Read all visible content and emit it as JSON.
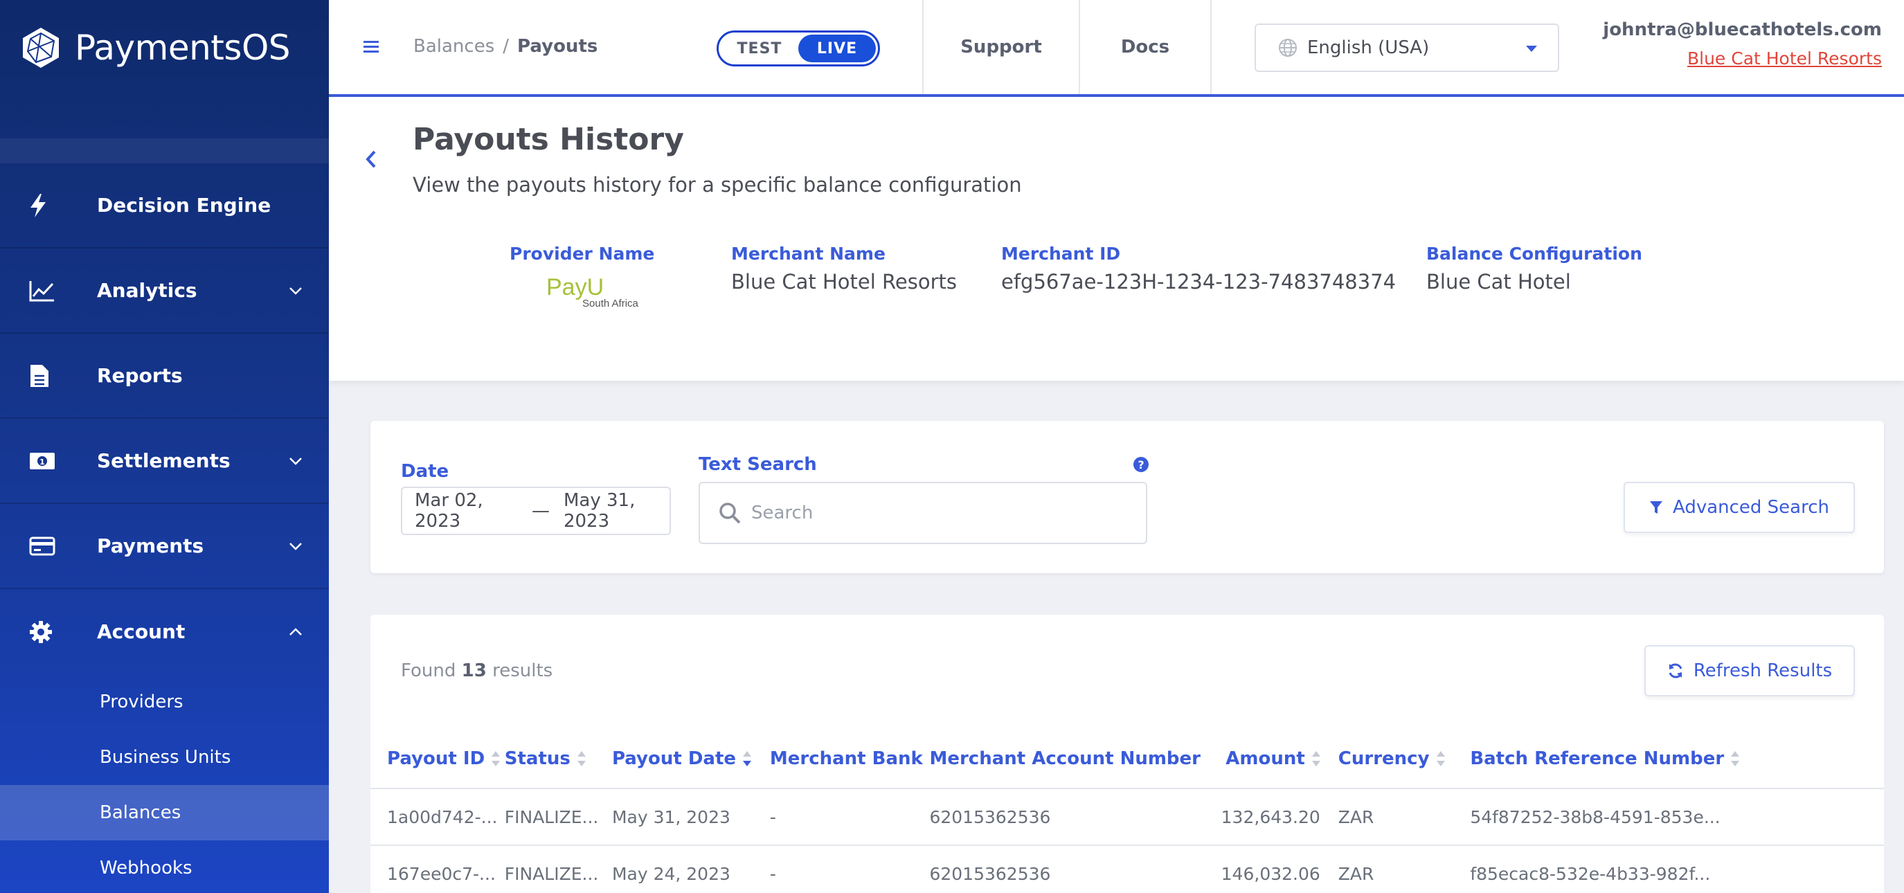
{
  "app": {
    "name": "PaymentsOS"
  },
  "sidebar": {
    "items": [
      {
        "label": "Decision Engine",
        "icon": "bolt-icon"
      },
      {
        "label": "Analytics",
        "icon": "line-chart-icon"
      },
      {
        "label": "Reports",
        "icon": "document-icon"
      },
      {
        "label": "Settlements",
        "icon": "money-icon"
      },
      {
        "label": "Payments",
        "icon": "credit-card-icon"
      },
      {
        "label": "Account",
        "icon": "gear-icon"
      }
    ],
    "account_sub": [
      "Providers",
      "Business Units",
      "Balances",
      "Webhooks"
    ],
    "active_sub": "Balances"
  },
  "topbar": {
    "breadcrumb_parent": "Balances",
    "breadcrumb_sep": "/",
    "breadcrumb_current": "Payouts",
    "env_test": "TEST",
    "env_live": "LIVE",
    "support": "Support",
    "docs": "Docs",
    "language": "English (USA)",
    "user_email": "johntra@bluecathotels.com",
    "user_company": "Blue Cat Hotel Resorts"
  },
  "header": {
    "title": "Payouts History",
    "subtitle": "View the payouts history for a specific balance configuration",
    "provider_label": "Provider Name",
    "provider_logo_text": "PayU",
    "provider_logo_sub": "South Africa",
    "merchant_name_label": "Merchant Name",
    "merchant_name": "Blue Cat Hotel Resorts",
    "merchant_id_label": "Merchant ID",
    "merchant_id": "efg567ae-123H-1234-123-7483748374",
    "balance_config_label": "Balance Configuration",
    "balance_config": "Blue Cat Hotel"
  },
  "search": {
    "date_label": "Date",
    "date_from": "Mar 02, 2023",
    "date_sep": "—",
    "date_to": "May 31, 2023",
    "text_label": "Text Search",
    "placeholder": "Search",
    "advanced_button": "Advanced Search"
  },
  "results": {
    "found_prefix": "Found",
    "count": "13",
    "found_suffix": "results",
    "refresh_button": "Refresh Results",
    "columns": [
      "Payout ID",
      "Status",
      "Payout Date",
      "Merchant Bank",
      "Merchant Account Number",
      "Amount",
      "Currency",
      "Batch Reference Number"
    ],
    "rows": [
      [
        "1a00d742-...",
        "FINALIZE...",
        "May 31, 2023",
        "-",
        "62015362536",
        "132,643.20",
        "ZAR",
        "54f87252-38b8-4591-853e..."
      ],
      [
        "167ee0c7-...",
        "FINALIZE...",
        "May 24, 2023",
        "-",
        "62015362536",
        "146,032.06",
        "ZAR",
        "f85ecac8-532e-4b33-982f..."
      ]
    ]
  },
  "colors": {
    "accent": "#3a5bd9",
    "sidebar_top": "#0f2a6b",
    "sidebar_bottom": "#1c45c4",
    "link_red": "#e0463a"
  }
}
